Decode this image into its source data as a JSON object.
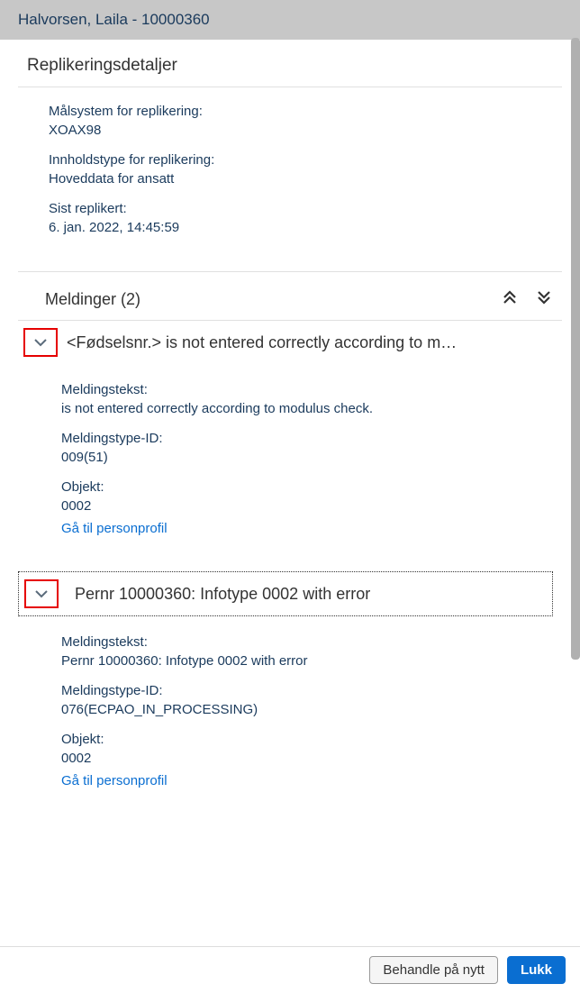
{
  "header": {
    "title": "Halvorsen, Laila - 10000360"
  },
  "details": {
    "section_title": "Replikeringsdetaljer",
    "target_system_label": "Målsystem for replikering:",
    "target_system_value": "XOAX98",
    "content_type_label": "Innholdstype for replikering:",
    "content_type_value": "Hoveddata for ansatt",
    "last_replicated_label": "Sist replikert:",
    "last_replicated_value": "6. jan. 2022, 14:45:59"
  },
  "messages": {
    "title": "Meldinger (2)",
    "items": [
      {
        "title": "<Fødselsnr.> is not entered correctly according to m…",
        "text_label": "Meldingstekst:",
        "text_value": "is not entered correctly according to modulus check.",
        "type_id_label": "Meldingstype-ID:",
        "type_id_value": "009(51)",
        "object_label": "Objekt:",
        "object_value": "0002",
        "link": "Gå til personprofil"
      },
      {
        "title": "Pernr 10000360: Infotype 0002 with error",
        "text_label": "Meldingstekst:",
        "text_value": "Pernr 10000360: Infotype 0002 with error",
        "type_id_label": "Meldingstype-ID:",
        "type_id_value": "076(ECPAO_IN_PROCESSING)",
        "object_label": "Objekt:",
        "object_value": "0002",
        "link": "Gå til personprofil"
      }
    ]
  },
  "footer": {
    "process_again": "Behandle på nytt",
    "close": "Lukk"
  }
}
